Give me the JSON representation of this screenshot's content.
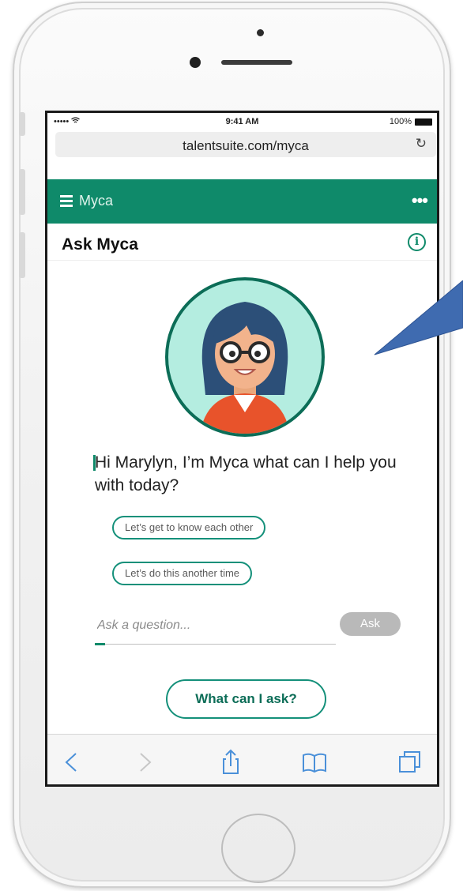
{
  "status_bar": {
    "signal": "••••• ",
    "time": "9:41 AM",
    "battery": "100%"
  },
  "browser": {
    "url": "talentsuite.com/myca",
    "reload_glyph": "↻"
  },
  "app_bar": {
    "title": "Myca",
    "more_glyph": "•••"
  },
  "subheader": {
    "title": "Ask Myca",
    "info_glyph": "i"
  },
  "chat": {
    "greeting": "Hi Marylyn, I’m Myca what can I help you with today?",
    "suggestions": [
      {
        "label": "Let’s get to know each other"
      },
      {
        "label": "Let’s do this another time"
      }
    ]
  },
  "ask": {
    "placeholder": "Ask a question...",
    "button_label": "Ask"
  },
  "help_button": {
    "label": "What can I ask?"
  },
  "toolbar": {
    "icons": [
      "back-icon",
      "forward-icon",
      "share-icon",
      "bookmarks-icon",
      "tabs-icon"
    ]
  },
  "colors": {
    "brand": "#0f8a6a",
    "avatar_bg": "#b4ede0",
    "callout": "#3f6bb0"
  }
}
